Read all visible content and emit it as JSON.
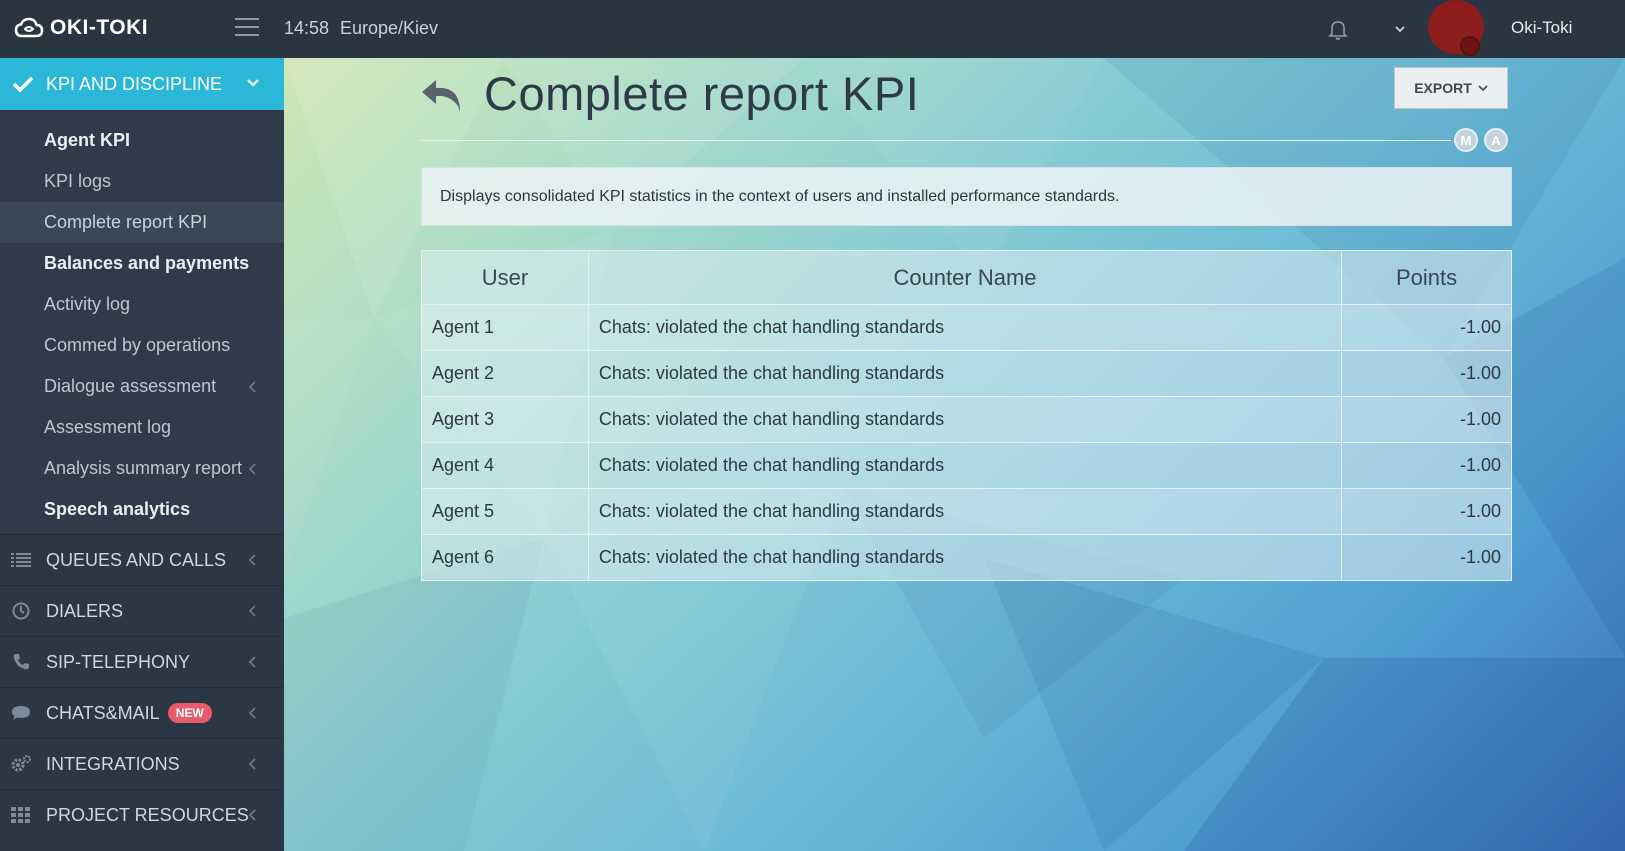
{
  "topbar": {
    "logo_text": "OKI-TOKI",
    "time": "14:58",
    "timezone": "Europe/Kiev",
    "user_name": "Oki-Toki"
  },
  "sidebar": {
    "active_section": "KPI AND DISCIPLINE",
    "sub_items": [
      {
        "label": "Agent KPI",
        "bold": true
      },
      {
        "label": "KPI logs"
      },
      {
        "label": "Complete report KPI",
        "current": true
      },
      {
        "label": "Balances and payments",
        "bold": true
      },
      {
        "label": "Activity log"
      },
      {
        "label": "Commed by operations"
      },
      {
        "label": "Dialogue assessment",
        "has_children": true
      },
      {
        "label": "Assessment log"
      },
      {
        "label": "Analysis summary report",
        "has_children": true
      },
      {
        "label": "Speech analytics",
        "bold": true
      }
    ],
    "sections": [
      {
        "label": "QUEUES AND CALLS",
        "icon": "list-icon"
      },
      {
        "label": "DIALERS",
        "icon": "clock-icon"
      },
      {
        "label": "SIP-TELEPHONY",
        "icon": "phone-icon"
      },
      {
        "label": "CHATS&MAIL",
        "icon": "chat-bubble-icon",
        "badge": "NEW"
      },
      {
        "label": "INTEGRATIONS",
        "icon": "gears-icon"
      },
      {
        "label": "PROJECT RESOURCES",
        "icon": "grid-icon"
      }
    ]
  },
  "main": {
    "title": "Complete report KPI",
    "export_label": "EXPORT",
    "pill_m": "M",
    "pill_a": "A",
    "description": "Displays consolidated KPI statistics in the context of users and installed performance standards.",
    "table": {
      "headers": [
        "User",
        "Counter Name",
        "Points"
      ],
      "rows": [
        [
          "Agent 1",
          "Chats: violated the chat handling standards",
          "-1.00"
        ],
        [
          "Agent 2",
          "Chats: violated the chat handling standards",
          "-1.00"
        ],
        [
          "Agent 3",
          "Chats: violated the chat handling standards",
          "-1.00"
        ],
        [
          "Agent 4",
          "Chats: violated the chat handling standards",
          "-1.00"
        ],
        [
          "Agent 5",
          "Chats: violated the chat handling standards",
          "-1.00"
        ],
        [
          "Agent 6",
          "Chats: violated the chat handling standards",
          "-1.00"
        ]
      ]
    }
  },
  "colors": {
    "accent": "#2bb8d8",
    "sidebar_bg": "#2b3745",
    "topbar_bg": "#2a3542",
    "badge_new": "#e85b6b"
  }
}
